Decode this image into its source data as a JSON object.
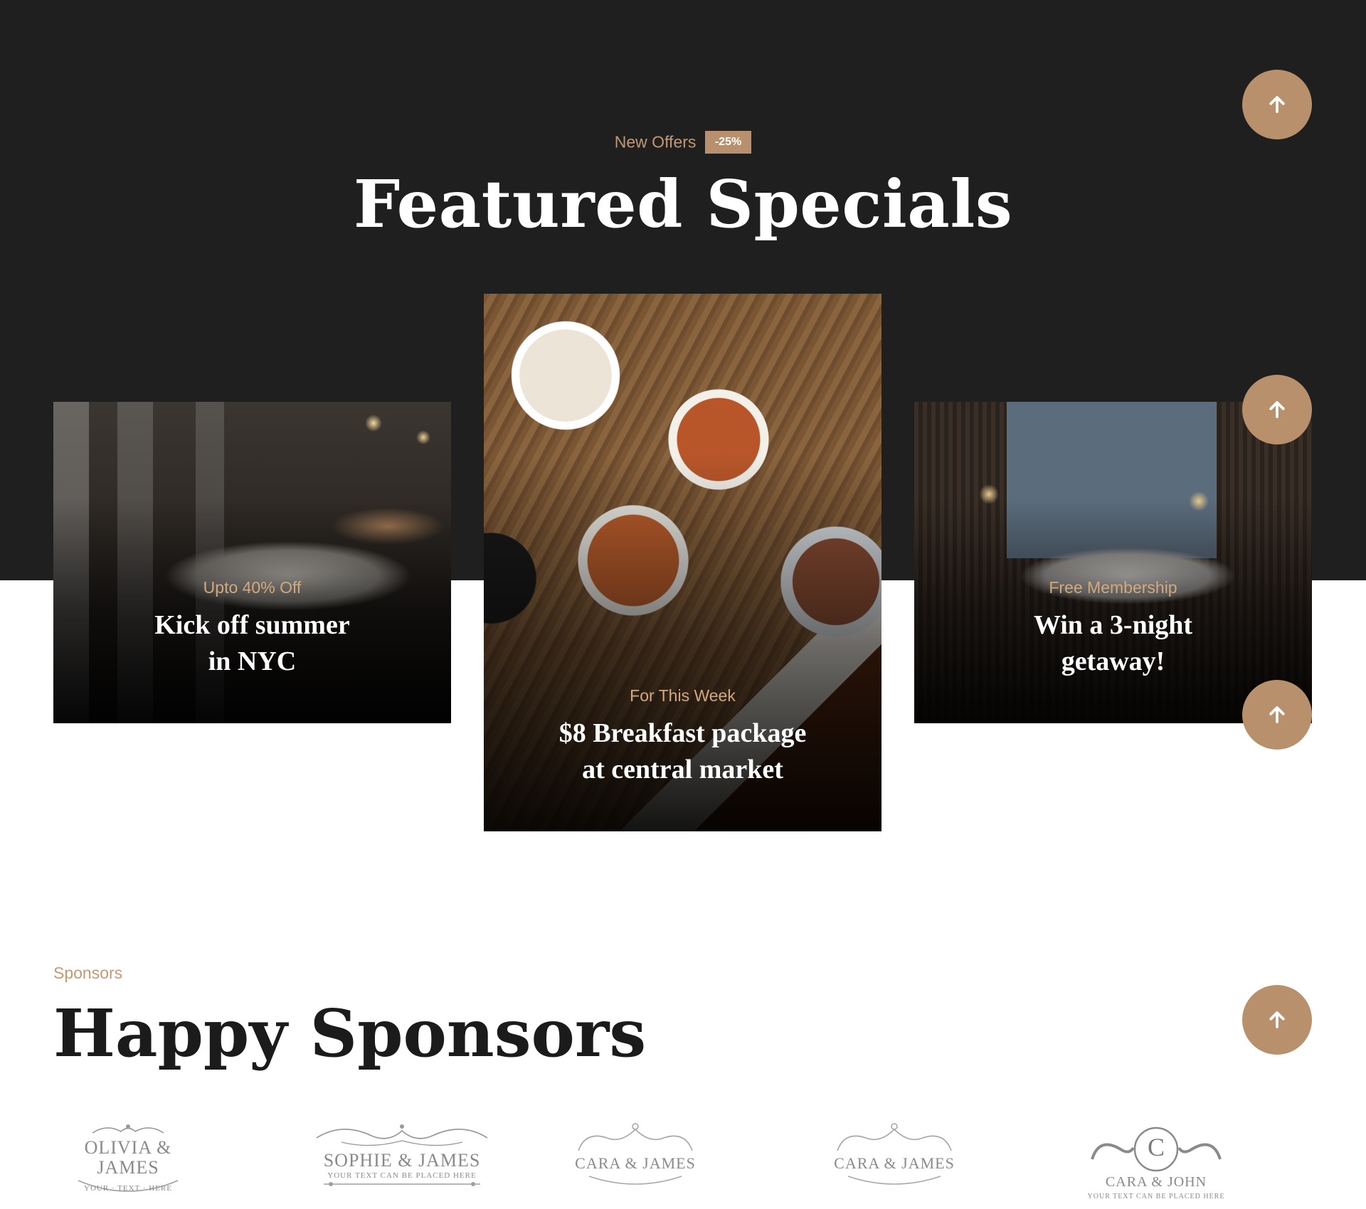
{
  "offers": {
    "eyebrow": "New Offers",
    "badge": "-25%",
    "title": "Featured Specials"
  },
  "cards": [
    {
      "tag": "Upto 40% Off",
      "headline_line1": "Kick off summer",
      "headline_line2": "in NYC"
    },
    {
      "tag": "For This Week",
      "headline_line1": "$8 Breakfast package",
      "headline_line2": "at central market"
    },
    {
      "tag": "Free Membership",
      "headline_line1": "Win a 3-night",
      "headline_line2": "getaway!"
    }
  ],
  "sponsors": {
    "eyebrow": "Sponsors",
    "title": "Happy Sponsors",
    "logos": [
      {
        "name": "OLIVIA & JAMES",
        "sub": "YOUR · TEXT · HERE"
      },
      {
        "name": "SOPHIE & JAMES",
        "sub": "YOUR TEXT CAN BE PLACED HERE"
      },
      {
        "name": "CARA & JAMES",
        "sub": ""
      },
      {
        "name": "CARA & JAMES",
        "sub": ""
      },
      {
        "name": "CARA & JOHN",
        "sub": "YOUR TEXT CAN BE PLACED HERE",
        "monogram": "C"
      }
    ]
  },
  "colors": {
    "accent": "#b8916c",
    "dark_band": "#201f20",
    "eyebrow": "#c19a73"
  },
  "icons": {
    "scroll_top": "arrow-up-icon"
  }
}
